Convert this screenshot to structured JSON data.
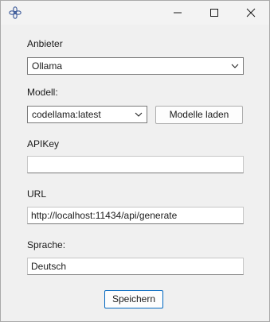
{
  "window": {
    "icon": "gear-flower-icon",
    "controls": {
      "minimize": "minimize-icon",
      "maximize": "maximize-icon",
      "close": "close-icon"
    }
  },
  "form": {
    "provider_label": "Anbieter",
    "provider_value": "Ollama",
    "model_label": "Modell:",
    "model_value": "codellama:latest",
    "load_models_button": "Modelle laden",
    "apikey_label": "APIKey",
    "apikey_value": "",
    "url_label": "URL",
    "url_value": "http://localhost:11434/api/generate",
    "language_label": "Sprache:",
    "language_value": "Deutsch",
    "save_button": "Speichern"
  },
  "colors": {
    "accent": "#0067c0",
    "window_bg": "#f0f0f0"
  }
}
